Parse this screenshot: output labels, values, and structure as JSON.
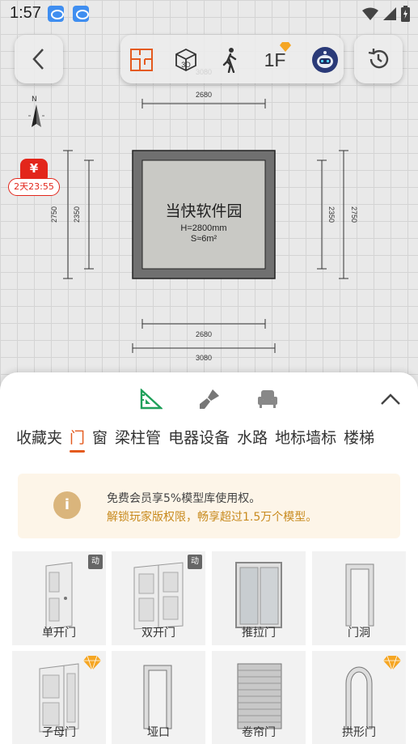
{
  "status_bar": {
    "time": "1:57"
  },
  "toolbar": {
    "floor_label": "1F"
  },
  "compass": {
    "north": "N"
  },
  "promo": {
    "symbol": "¥",
    "countdown": "2天23:55"
  },
  "plan": {
    "room_name": "当快软件园",
    "height": "H=2800mm",
    "area": "S≈6m²",
    "dim_outer_width": "3080",
    "dim_inner_width": "2680",
    "dim_outer_height": "2750",
    "dim_inner_height": "2350"
  },
  "panel": {
    "categories": [
      "收藏夹",
      "门",
      "窗",
      "梁柱管",
      "电器设备",
      "水路",
      "地标墙标",
      "楼梯"
    ],
    "active_category": "门",
    "notice_line1": "免费会员享5%模型库使用权。",
    "notice_line2": "解锁玩家版权限，畅享超过1.5万个模型。",
    "notice_icon": "i",
    "items": [
      {
        "label": "单开门",
        "badge": "动"
      },
      {
        "label": "双开门",
        "badge": "动"
      },
      {
        "label": "推拉门",
        "badge": ""
      },
      {
        "label": "门洞",
        "badge": ""
      },
      {
        "label": "子母门",
        "badge": "gem"
      },
      {
        "label": "垭口",
        "badge": ""
      },
      {
        "label": "卷帘门",
        "badge": ""
      },
      {
        "label": "拱形门",
        "badge": "gem"
      }
    ]
  },
  "colors": {
    "accent": "#e45a1e",
    "promo_red": "#e3261b",
    "gem": "#f5a623",
    "notice_bg": "#fdf5e8"
  }
}
